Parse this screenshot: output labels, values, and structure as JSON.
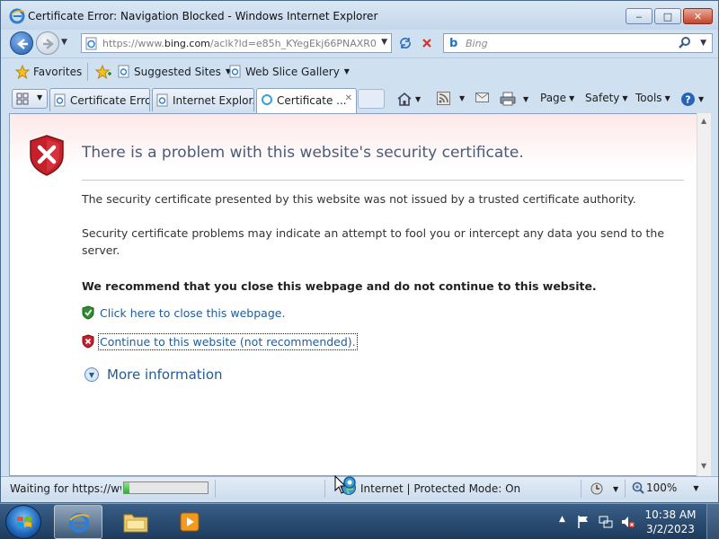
{
  "window": {
    "title": "Certificate Error: Navigation Blocked - Windows Internet Explorer",
    "minimize": "‒",
    "maximize": "□",
    "close": "✕"
  },
  "address_bar": {
    "url_prefix": "https://www.",
    "url_domain": "bing.com",
    "url_rest": "/aclk?ld=e85h_KYegEkj66PNAXR0\\"
  },
  "search": {
    "placeholder": "Bing"
  },
  "favorites_bar": {
    "favorites_label": "Favorites",
    "suggested_sites_label": "Suggested Sites",
    "web_slice_label": "Web Slice Gallery"
  },
  "tabs": [
    {
      "label": "Certificate Erro..."
    },
    {
      "label": "Internet Explor..."
    },
    {
      "label": "Certificate ..."
    }
  ],
  "command_bar": {
    "page_label": "Page",
    "safety_label": "Safety",
    "tools_label": "Tools"
  },
  "page": {
    "heading": "There is a problem with this website's security certificate.",
    "para1": "The security certificate presented by this website was not issued by a trusted certificate authority.",
    "para2": "Security certificate problems may indicate an attempt to fool you or intercept any data you send to the server.",
    "recommendation": "We recommend that you close this webpage and do not continue to this website.",
    "close_link": "Click here to close this webpage.",
    "continue_link": "Continue to this website (not recommended).",
    "more_info": "More information"
  },
  "status_bar": {
    "status_text": "Waiting for https://www",
    "progress": 0.06,
    "zone_text": "Internet | Protected Mode: On",
    "zoom": "100%"
  },
  "taskbar": {
    "time": "10:38 AM",
    "date": "3/2/2023"
  },
  "colors": {
    "link": "#1f5c9a",
    "heading": "#4b5b74",
    "shield_red": "#c8202b",
    "shield_green": "#2f8f2f"
  },
  "icons": [
    "ie-icon",
    "back-arrow-icon",
    "forward-arrow-icon",
    "refresh-icon",
    "stop-icon",
    "bing-icon",
    "search-icon",
    "star-icon",
    "add-favorites-icon",
    "home-icon",
    "rss-icon",
    "mail-icon",
    "print-icon",
    "help-icon",
    "red-shield-icon",
    "green-shield-icon",
    "chevron-down-icon",
    "globe-icon",
    "zoom-icon",
    "start-orb-icon",
    "folder-icon",
    "media-player-icon",
    "flag-icon",
    "network-icon",
    "volume-muted-icon"
  ]
}
